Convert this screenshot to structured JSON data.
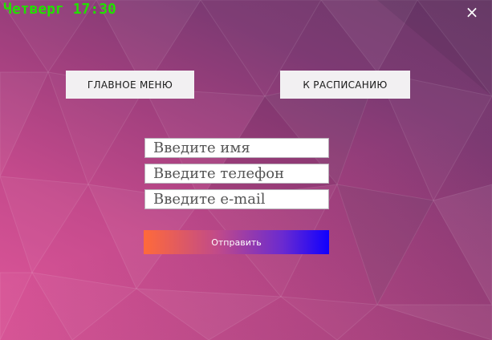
{
  "header": {
    "clock": "Четверг 17:30",
    "close_icon": "×"
  },
  "nav": {
    "main_menu_label": "ГЛАВНОЕ МЕНЮ",
    "schedule_label": "К РАСПИСАНИЮ"
  },
  "form": {
    "name_placeholder": "Введите имя",
    "phone_placeholder": "Введите телефон",
    "email_placeholder": "Введите e-mail",
    "name_value": "",
    "phone_value": "",
    "email_value": "",
    "submit_label": "Отправить"
  },
  "colors": {
    "clock": "#22e000",
    "background_start": "#e0579a",
    "background_end": "#6a3868",
    "submit_gradient_start": "#ff6a3a",
    "submit_gradient_end": "#1000ff"
  }
}
